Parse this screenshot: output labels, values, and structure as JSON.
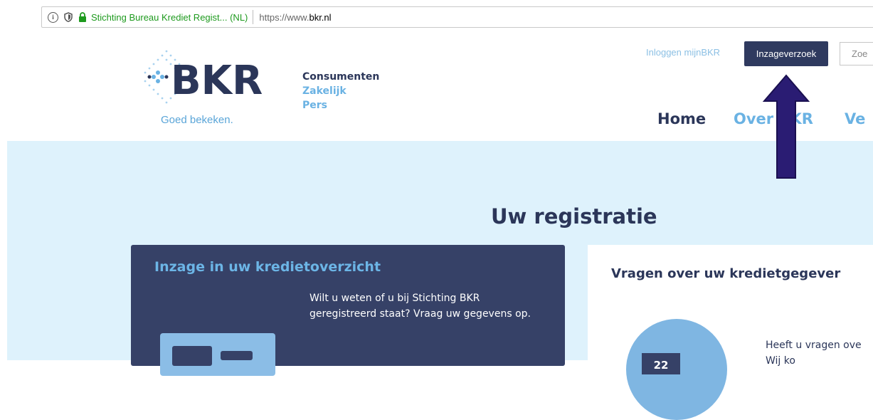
{
  "browser": {
    "site_identity": "Stichting Bureau Krediet Regist... (NL)",
    "url_prefix": "https://www.",
    "url_domain": "bkr.nl"
  },
  "header": {
    "logo_text": "BKR",
    "logo_tagline": "Goed bekeken.",
    "segments": [
      "Consumenten",
      "Zakelijk",
      "Pers"
    ],
    "login_link": "Inloggen mijnBKR",
    "inzage_button": "Inzageverzoek",
    "search_placeholder": "Zoe",
    "nav": {
      "home": "Home",
      "over": "Over BKR",
      "ve": "Ve"
    }
  },
  "hero": {
    "title": "Uw registratie",
    "card_left": {
      "title": "Inzage in uw kredietoverzicht",
      "text": "Wilt u weten of u bij Stichting BKR geregistreerd staat? Vraag uw gegevens op."
    },
    "card_right": {
      "title": "Vragen over uw kredietgegever",
      "badge": "22",
      "text_line1": "Heeft u vragen ove",
      "text_line2": "Wij ko"
    }
  },
  "colors": {
    "navy": "#2b3659",
    "light_blue": "#6ab2e3",
    "hero_bg": "#def2fc",
    "card_dark": "#364167",
    "annotation_arrow": "#2a1c73"
  }
}
